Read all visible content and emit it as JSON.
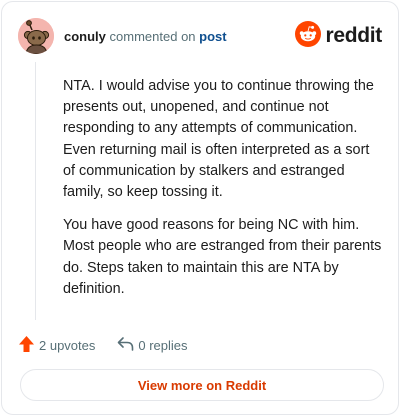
{
  "header": {
    "username": "conuly",
    "action_text": "commented on",
    "post_link": "post",
    "brand_name": "reddit",
    "avatar_icon": "snoo-avatar-icon",
    "brand_icon": "reddit-logo-icon"
  },
  "comment": {
    "paragraphs": [
      "NTA. I would advise you to continue throwing the presents out, unopened, and continue not responding to any attempts of communication. Even returning mail is often interpreted as a sort of communication by stalkers and estranged family, so keep tossing it.",
      "You have good reasons for being NC with him. Most people who are estranged from their parents do. Steps taken to maintain this are NTA by definition."
    ]
  },
  "actions": {
    "upvotes": "2 upvotes",
    "replies": "0 replies",
    "upvote_icon": "upvote-arrow-icon",
    "reply_icon": "reply-arrow-icon"
  },
  "footer": {
    "view_more_label": "View more on Reddit"
  },
  "colors": {
    "accent": "#d93a00",
    "brand_orange": "#ff4500",
    "muted_text": "#576f76",
    "link_blue": "#0f4f8f",
    "border": "#e5e7eb",
    "avatar_bg": "#f4b5ae"
  }
}
